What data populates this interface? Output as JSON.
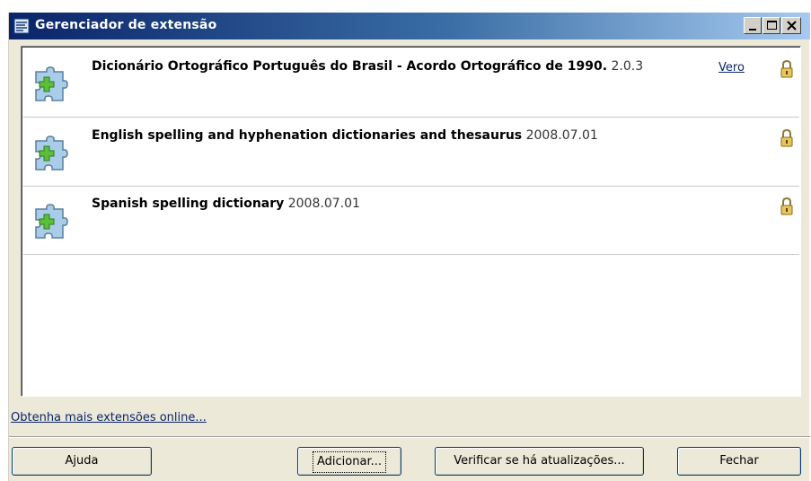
{
  "window": {
    "title": "Gerenciador de extensão",
    "controls": {
      "minimize": "minimize-icon",
      "maximize": "maximize-icon",
      "close": "close-icon"
    }
  },
  "extensions": [
    {
      "name": "Dicionário Ortográfico Português do Brasil - Acordo Ortográfico de 1990.",
      "version": "2.0.3",
      "link": "Vero",
      "icon": "puzzle-icon",
      "status_icon": "lock-icon"
    },
    {
      "name": "English spelling and hyphenation dictionaries and thesaurus",
      "version": "2008.07.01",
      "icon": "puzzle-icon",
      "status_icon": "lock-icon"
    },
    {
      "name": "Spanish spelling dictionary",
      "version": "2008.07.01",
      "icon": "puzzle-icon",
      "status_icon": "lock-icon"
    }
  ],
  "more_link": "Obtenha mais extensões online...",
  "buttons": {
    "help": "Ajuda",
    "add": "Adicionar...",
    "check_updates": "Verificar se há atualizações...",
    "close": "Fechar"
  },
  "colors": {
    "title_gradient_start": "#0a246a",
    "title_gradient_end": "#a6caf0",
    "dialog_bg": "#ece9d8",
    "link": "#0a246a"
  }
}
